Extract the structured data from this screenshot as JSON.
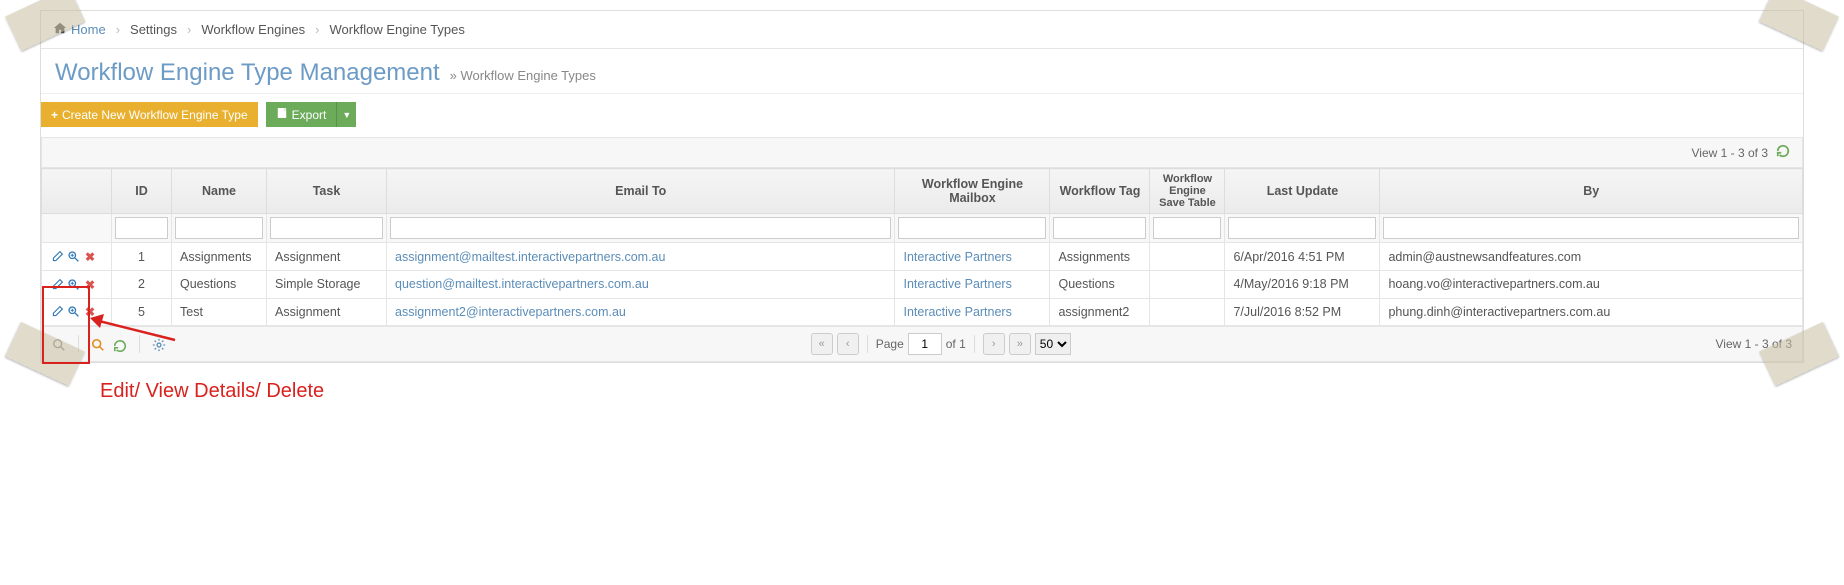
{
  "breadcrumb": {
    "home": "Home",
    "settings": "Settings",
    "engines": "Workflow Engines",
    "types": "Workflow Engine Types"
  },
  "header": {
    "title": "Workflow Engine Type Management",
    "subtitle": "» Workflow Engine Types"
  },
  "buttons": {
    "create": "Create New Workflow Engine Type",
    "export": "Export"
  },
  "table": {
    "topinfo": "View 1 - 3 of 3",
    "columns": [
      "",
      "ID",
      "Name",
      "Task",
      "Email To",
      "Workflow Engine Mailbox",
      "Workflow Tag",
      "Workflow Engine Save Table",
      "Last Update",
      "By"
    ],
    "rows": [
      {
        "id": "1",
        "name": "Assignments",
        "task": "Assignment",
        "email": "assignment@mailtest.interactivepartners.com.au",
        "mailbox": "Interactive Partners",
        "tag": "Assignments",
        "save": "",
        "update": "6/Apr/2016 4:51 PM",
        "by": "admin@austnewsandfeatures.com"
      },
      {
        "id": "2",
        "name": "Questions",
        "task": "Simple Storage",
        "email": "question@mailtest.interactivepartners.com.au",
        "mailbox": "Interactive Partners",
        "tag": "Questions",
        "save": "",
        "update": "4/May/2016 9:18 PM",
        "by": "hoang.vo@interactivepartners.com.au"
      },
      {
        "id": "5",
        "name": "Test",
        "task": "Assignment",
        "email": "assignment2@interactivepartners.com.au",
        "mailbox": "Interactive Partners",
        "tag": "assignment2",
        "save": "",
        "update": "7/Jul/2016 8:52 PM",
        "by": "phung.dinh@interactivepartners.com.au"
      }
    ]
  },
  "footer": {
    "page_label": "Page",
    "of_label": "of 1",
    "page_value": "1",
    "page_size": "50",
    "info": "View 1 - 3 of 3"
  },
  "annotation": {
    "label": "Edit/ View Details/ Delete"
  }
}
